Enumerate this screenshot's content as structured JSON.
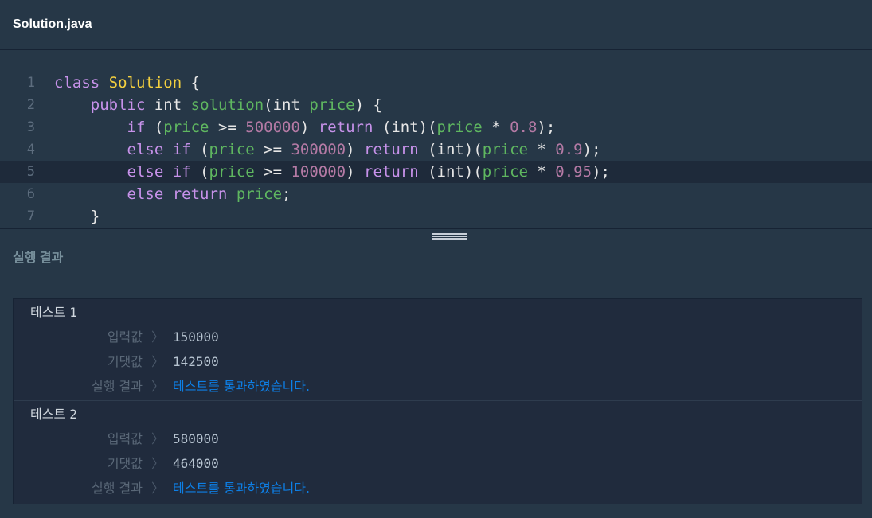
{
  "file_header": {
    "title": "Solution.java"
  },
  "editor": {
    "line_numbers": [
      "1",
      "2",
      "3",
      "4",
      "5",
      "6",
      "7"
    ],
    "active_line": 5
  },
  "result_panel": {
    "title": "실행 결과"
  },
  "tests": [
    {
      "title": "테스트 ",
      "number": "1",
      "input_label": "입력값",
      "input_value": "150000",
      "expected_label": "기댓값",
      "expected_value": "142500",
      "result_label": "실행 결과",
      "result_value": "테스트를 통과하였습니다."
    },
    {
      "title": "테스트 ",
      "number": "2",
      "input_label": "입력값",
      "input_value": "580000",
      "expected_label": "기댓값",
      "expected_value": "464000",
      "result_label": "실행 결과",
      "result_value": "테스트를 통과하였습니다."
    }
  ],
  "separator_glyph": "〉",
  "colors": {
    "background": "#263747",
    "keyword": "#c792ea",
    "class_name": "#f4d03f",
    "identifier": "#5fb760",
    "number": "#b57aa5",
    "pass": "#0d7fe6"
  },
  "code": {
    "l1": [
      "class",
      " ",
      "Solution",
      " {"
    ],
    "l2": [
      "    ",
      "public",
      " ",
      "int",
      " ",
      "solution",
      "(",
      "int",
      " ",
      "price",
      ") {"
    ],
    "l3": [
      "        ",
      "if",
      " (",
      "price",
      " >= ",
      "500000",
      ") ",
      "return",
      " (",
      "int",
      ")(",
      "price",
      " * ",
      "0.8",
      ");"
    ],
    "l4": [
      "        ",
      "else",
      " ",
      "if",
      " (",
      "price",
      " >= ",
      "300000",
      ") ",
      "return",
      " (",
      "int",
      ")(",
      "price",
      " * ",
      "0.9",
      ");"
    ],
    "l5": [
      "        ",
      "else",
      " ",
      "if",
      " (",
      "price",
      " >= ",
      "100000",
      ") ",
      "return",
      " (",
      "int",
      ")(",
      "price",
      " * ",
      "0.95",
      ");"
    ],
    "l6": [
      "        ",
      "else",
      " ",
      "return",
      " ",
      "price",
      ";"
    ],
    "l7": [
      "    ",
      "}"
    ]
  }
}
